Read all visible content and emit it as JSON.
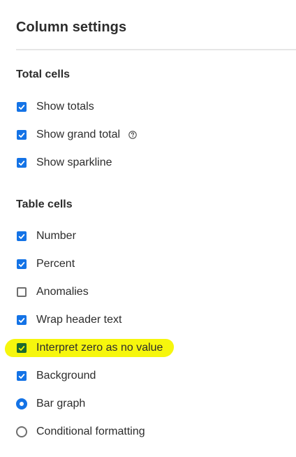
{
  "panel": {
    "title": "Column settings"
  },
  "total_cells": {
    "heading": "Total cells",
    "items": [
      {
        "label": "Show totals",
        "type": "checkbox",
        "checked": true
      },
      {
        "label": "Show grand total",
        "type": "checkbox",
        "checked": true,
        "icon": "help-icon"
      },
      {
        "label": "Show sparkline",
        "type": "checkbox",
        "checked": true
      }
    ]
  },
  "table_cells": {
    "heading": "Table cells",
    "items": [
      {
        "label": "Number",
        "type": "checkbox",
        "checked": true
      },
      {
        "label": "Percent",
        "type": "checkbox",
        "checked": true
      },
      {
        "label": "Anomalies",
        "type": "checkbox",
        "checked": false
      },
      {
        "label": "Wrap header text",
        "type": "checkbox",
        "checked": true
      },
      {
        "label": "Interpret zero as no value",
        "type": "checkbox",
        "checked": true,
        "highlighted": true
      },
      {
        "label": "Background",
        "type": "checkbox",
        "checked": true
      },
      {
        "label": "Bar graph",
        "type": "radio",
        "checked": true
      },
      {
        "label": "Conditional formatting",
        "type": "radio",
        "checked": false
      }
    ]
  },
  "colors": {
    "accent": "#1473e6",
    "highlight": "#f5f500",
    "text": "#2c2c2c"
  }
}
